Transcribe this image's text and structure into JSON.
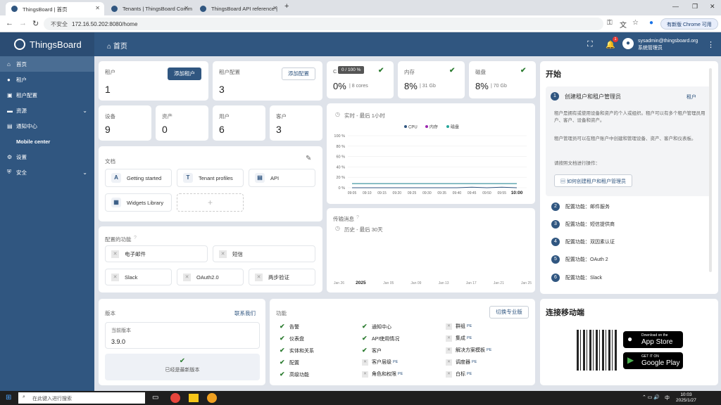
{
  "browser": {
    "tabs": [
      {
        "label": "ThingsBoard | 首页"
      },
      {
        "label": "Tenants | ThingsBoard Comm"
      },
      {
        "label": "ThingsBoard API reference |"
      }
    ],
    "add_tab": "+",
    "security_label": "不安全",
    "url": "172.16.50.202:8080/home",
    "update_label": "有新版 Chrome 可用"
  },
  "brand": {
    "name": "ThingsBoard"
  },
  "sidebar": {
    "items": [
      {
        "label": "首页"
      },
      {
        "label": "租户"
      },
      {
        "label": "租户配置"
      },
      {
        "label": "资源"
      },
      {
        "label": "通知中心"
      },
      {
        "label": "Mobile center"
      },
      {
        "label": "设置"
      },
      {
        "label": "安全"
      }
    ]
  },
  "header": {
    "title": "首页",
    "notif_count": "1",
    "user_email": "sysadmin@thingsboard.org",
    "user_role": "系统管理员"
  },
  "stats": {
    "tenants": {
      "label": "租户",
      "value": "1",
      "button": "添加租户"
    },
    "profiles": {
      "label": "租户配置",
      "value": "3",
      "button": "添加配置"
    },
    "devices": {
      "label": "设备",
      "value": "9"
    },
    "assets": {
      "label": "资产",
      "value": "0"
    },
    "users": {
      "label": "用户",
      "value": "6"
    },
    "customers": {
      "label": "客户",
      "value": "3"
    }
  },
  "system": {
    "cpu": {
      "label": "C",
      "tooltip": "0 / 100 %",
      "value": "0%",
      "detail": "| 8 cores"
    },
    "memory": {
      "label": "内存",
      "value": "8%",
      "detail": "| 31 Gb"
    },
    "disk": {
      "label": "磁盘",
      "value": "8%",
      "detail": "| 70 Gb"
    }
  },
  "realtime": {
    "label": "实时 - 最后 1小时",
    "legend": [
      "CPU",
      "内存",
      "磁盘"
    ],
    "legend_colors": [
      "#305680",
      "#9c27b0",
      "#26a69a"
    ]
  },
  "chart_data": [
    {
      "type": "line",
      "title": "实时 - 最后 1小时",
      "x": [
        "09:05",
        "09:10",
        "09:15",
        "09:20",
        "09:25",
        "09:30",
        "09:35",
        "09:40",
        "09:45",
        "09:50",
        "09:55",
        "10:00"
      ],
      "yticks": [
        "100 %",
        "80 %",
        "60 %",
        "40 %",
        "20 %",
        "0 %"
      ],
      "ylim": [
        0,
        100
      ],
      "series": [
        {
          "name": "CPU",
          "values": [
            0,
            0,
            0,
            0,
            0,
            0,
            0,
            0,
            1,
            0,
            1,
            0
          ]
        },
        {
          "name": "内存",
          "values": [
            8,
            8,
            8,
            8,
            8,
            8,
            8,
            8,
            8,
            8,
            8,
            8
          ]
        },
        {
          "name": "磁盘",
          "values": [
            8,
            8,
            8,
            8,
            8,
            8,
            8,
            8,
            8,
            8,
            8,
            8
          ]
        }
      ]
    },
    {
      "type": "line",
      "title": "历史 - 最后 30天",
      "x": [
        "Jan 26",
        "2025",
        "Jan 05",
        "Jan 09",
        "Jan 13",
        "Jan 17",
        "Jan 21",
        "Jan 25"
      ],
      "series": []
    }
  ],
  "docs": {
    "label": "文档",
    "items": [
      {
        "icon": "A",
        "label": "Getting started"
      },
      {
        "icon": "T",
        "label": "Tenant profiles"
      },
      {
        "icon": "▤",
        "label": "API"
      },
      {
        "icon": "▦",
        "label": "Widgets Library"
      }
    ],
    "add": "+"
  },
  "transport": {
    "label": "传输消息",
    "history": "历史 - 最后 30天"
  },
  "configured": {
    "label": "配置的功能",
    "items": [
      "电子邮件",
      "短信",
      "Slack",
      "OAuth2.0",
      "两步验证"
    ]
  },
  "version": {
    "label": "版本",
    "contact": "联系我们",
    "current_label": "当前版本",
    "current": "3.9.0",
    "status": "已经是最新版本"
  },
  "features": {
    "label": "功能",
    "upgrade": "切换专业版",
    "pe_mark": "PE",
    "col1": [
      "告警",
      "仪表盘",
      "实体和关系",
      "配置",
      "高级功能"
    ],
    "col2": [
      "通知中心",
      "API使用情况",
      "客户",
      "客户层级",
      "角色和权限"
    ],
    "col3": [
      "群组",
      "集成",
      "解决方案模板",
      "调度器",
      "白标"
    ]
  },
  "getting_started": {
    "title": "开始",
    "steps": [
      {
        "num": "1",
        "label": "创建租户和租户管理员",
        "link": "租户"
      },
      {
        "num": "2",
        "label": "配置功能：邮件服务"
      },
      {
        "num": "3",
        "label": "配置功能：短信提供商"
      },
      {
        "num": "4",
        "label": "配置功能：双因素认证"
      },
      {
        "num": "5",
        "label": "配置功能：OAuth 2"
      },
      {
        "num": "6",
        "label": "配置功能：Slack"
      }
    ],
    "desc1": "租户是拥有或使用设备和资产的个人或组织。租户可以有多个租户管理员用户、客户、设备和资产。",
    "desc2": "租户管理员可以在租户账户中创建和管理设备、资产、客户和仪表板。",
    "desc3": "请按照文档进行操作：",
    "doc_button": "如何创建租户和租户管理员"
  },
  "mobile": {
    "title": "连接移动端",
    "appstore_small": "Download on the",
    "appstore": "App Store",
    "gplay_small": "GET IT ON",
    "gplay": "Google Play"
  },
  "taskbar": {
    "search": "在此键入进行搜索",
    "time": "10:03",
    "date": "2025/1/27",
    "ime": "中"
  }
}
